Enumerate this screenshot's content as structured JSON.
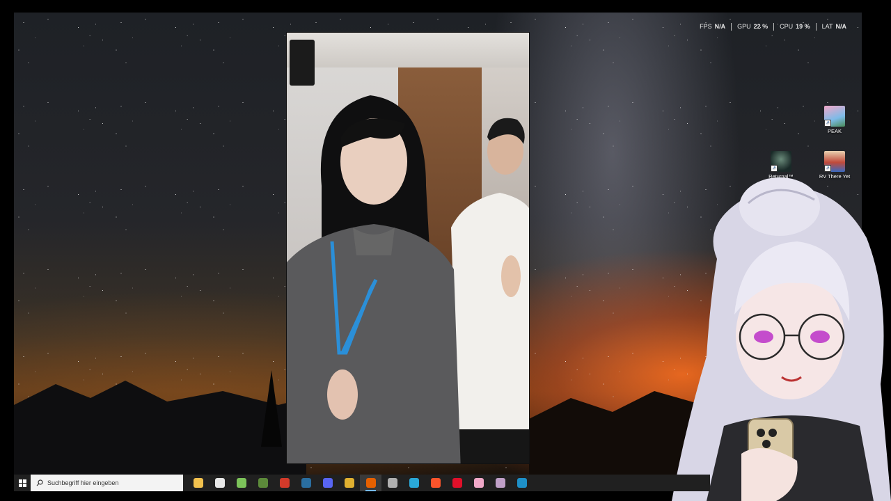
{
  "hud": {
    "fps_label": "FPS",
    "fps_value": "N/A",
    "gpu_label": "GPU",
    "gpu_value": "22 %",
    "cpu_label": "CPU",
    "cpu_value": "19 %",
    "lat_label": "LAT",
    "lat_value": "N/A"
  },
  "desktop_icons": [
    {
      "label": "PEAK",
      "icon": "peak-game-icon"
    },
    {
      "label": "Returnal™",
      "icon": "returnal-game-icon"
    },
    {
      "label": "RV There Yet",
      "icon": "rv-there-yet-game-icon"
    }
  ],
  "taskbar": {
    "search_placeholder": "Suchbegriff hier eingeben",
    "apps": [
      {
        "name": "file-explorer",
        "color": "#f2c14e"
      },
      {
        "name": "microsoft-store",
        "color": "#e8e8e8"
      },
      {
        "name": "android-app",
        "color": "#7cc35a"
      },
      {
        "name": "minecraft",
        "color": "#5c8a3a"
      },
      {
        "name": "reddit-like-app",
        "color": "#d23a2a"
      },
      {
        "name": "steam",
        "color": "#2a6ea0"
      },
      {
        "name": "discord",
        "color": "#5865f2"
      },
      {
        "name": "chrome",
        "color": "#e0b030"
      },
      {
        "name": "firefox",
        "color": "#e66000",
        "active": true
      },
      {
        "name": "clock-app",
        "color": "#b0b0b0"
      },
      {
        "name": "refresh-app",
        "color": "#2aa8d8"
      },
      {
        "name": "brave",
        "color": "#fb542b"
      },
      {
        "name": "opera",
        "color": "#e0102a"
      },
      {
        "name": "heart-app",
        "color": "#f0a8c8"
      },
      {
        "name": "pen-app",
        "color": "#c0a0c8"
      },
      {
        "name": "steam-2",
        "color": "#1e90c8"
      }
    ]
  },
  "colors": {
    "taskbar_bg": "#202020",
    "search_bg": "#f3f3f3",
    "active_indicator": "#76b9ed"
  }
}
